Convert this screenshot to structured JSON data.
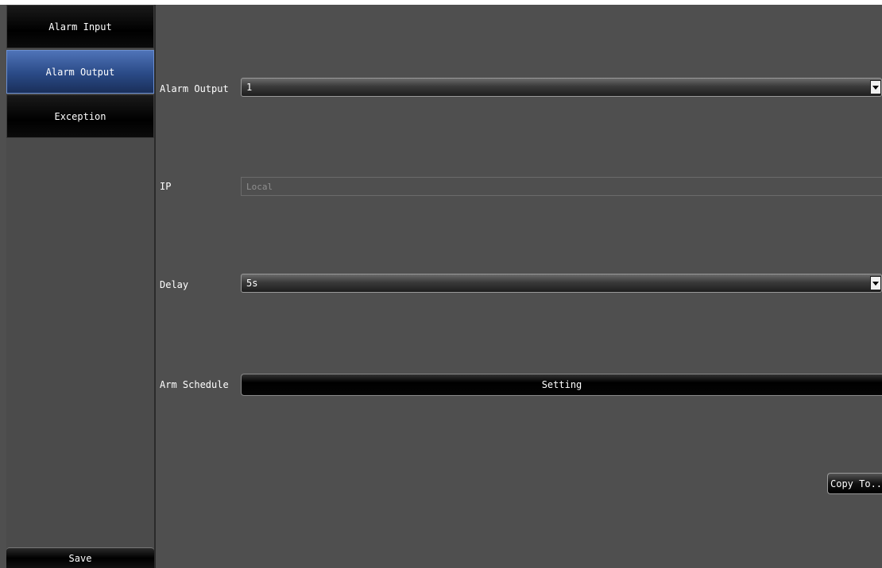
{
  "sidebar": {
    "items": [
      {
        "label": "Alarm Input",
        "active": false
      },
      {
        "label": "Alarm Output",
        "active": true
      },
      {
        "label": "Exception",
        "active": false
      }
    ],
    "save_label": "Save"
  },
  "form": {
    "alarm_output": {
      "label": "Alarm Output",
      "value": "1"
    },
    "ip": {
      "label": "IP",
      "value": "Local"
    },
    "delay": {
      "label": "Delay",
      "value": "5s"
    },
    "arm_schedule": {
      "label": "Arm Schedule",
      "button_label": "Setting"
    }
  },
  "copy_to_label": "Copy To..",
  "colors": {
    "background": "#4f4f4f",
    "active_tab": "#2a4a86",
    "button": "#000000",
    "disabled_text": "#8f8f8f"
  }
}
